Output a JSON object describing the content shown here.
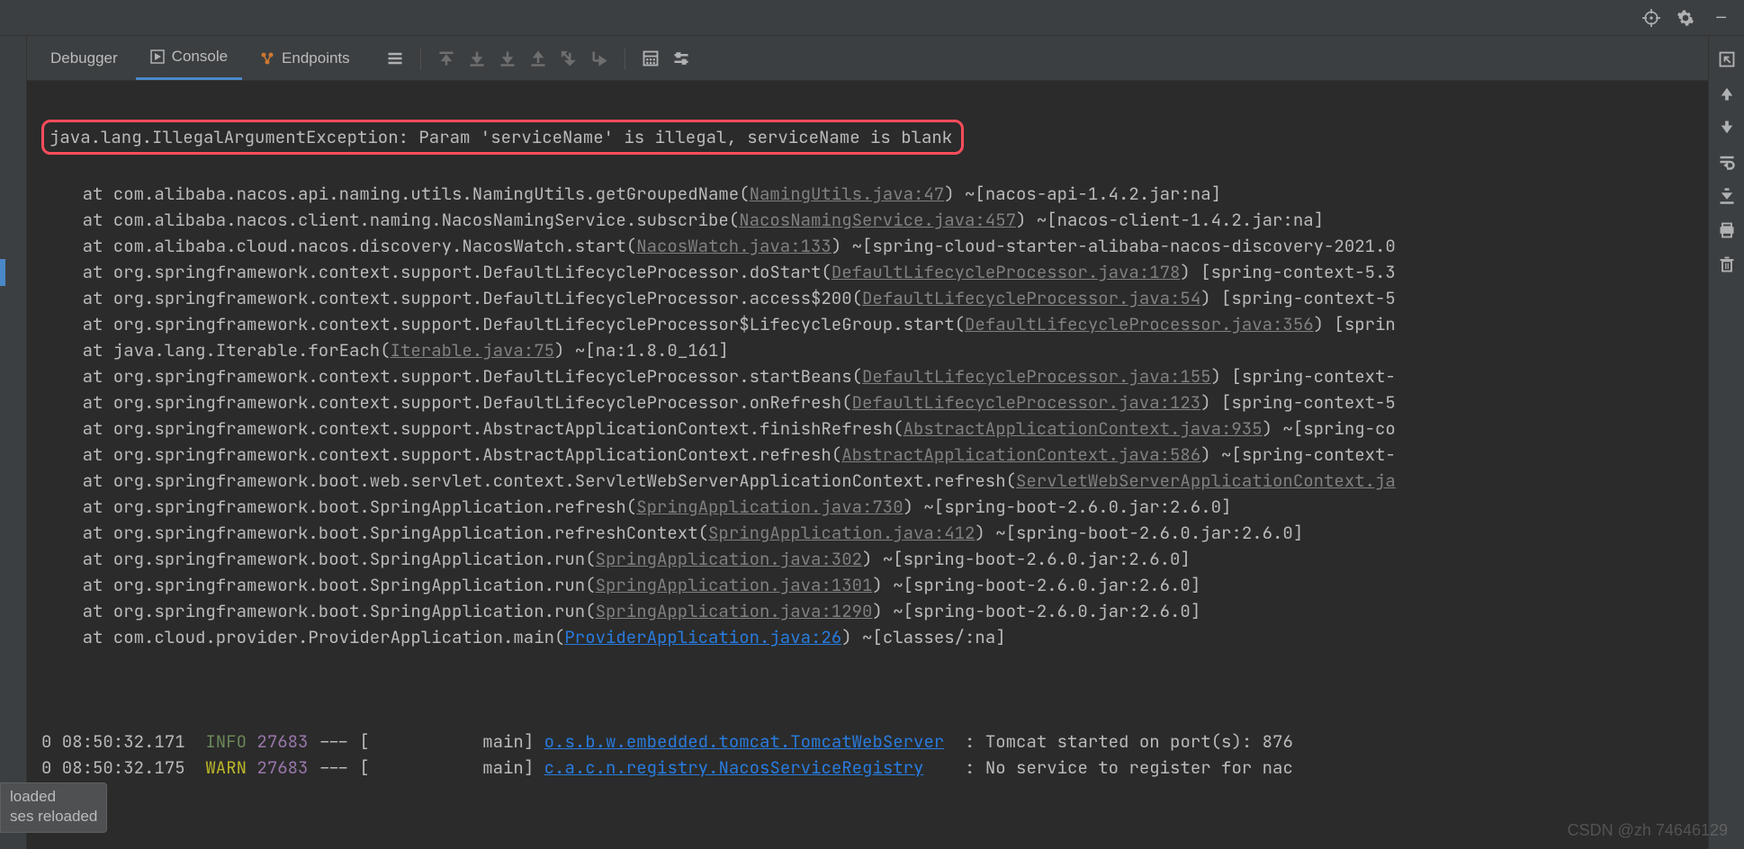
{
  "topbar": {},
  "tabs": {
    "debugger": "Debugger",
    "console": "Console",
    "endpoints": "Endpoints"
  },
  "exception": {
    "message": "java.lang.IllegalArgumentException: Param 'serviceName' is illegal, serviceName is blank"
  },
  "stack": [
    {
      "prefix": "    at com.alibaba.nacos.api.naming.utils.NamingUtils.getGroupedName(",
      "link": "NamingUtils.java:47",
      "linkClass": "grey",
      "suffix": ") ~[nacos-api-1.4.2.jar:na]"
    },
    {
      "prefix": "    at com.alibaba.nacos.client.naming.NacosNamingService.subscribe(",
      "link": "NacosNamingService.java:457",
      "linkClass": "grey",
      "suffix": ") ~[nacos-client-1.4.2.jar:na]"
    },
    {
      "prefix": "    at com.alibaba.cloud.nacos.discovery.NacosWatch.start(",
      "link": "NacosWatch.java:133",
      "linkClass": "grey",
      "suffix": ") ~[spring-cloud-starter-alibaba-nacos-discovery-2021.0"
    },
    {
      "prefix": "    at org.springframework.context.support.DefaultLifecycleProcessor.doStart(",
      "link": "DefaultLifecycleProcessor.java:178",
      "linkClass": "grey",
      "suffix": ") [spring-context-5.3"
    },
    {
      "prefix": "    at org.springframework.context.support.DefaultLifecycleProcessor.access$200(",
      "link": "DefaultLifecycleProcessor.java:54",
      "linkClass": "grey",
      "suffix": ") [spring-context-5"
    },
    {
      "prefix": "    at org.springframework.context.support.DefaultLifecycleProcessor$LifecycleGroup.start(",
      "link": "DefaultLifecycleProcessor.java:356",
      "linkClass": "grey",
      "suffix": ") [sprin"
    },
    {
      "prefix": "    at java.lang.Iterable.forEach(",
      "link": "Iterable.java:75",
      "linkClass": "grey",
      "suffix": ") ~[na:1.8.0_161]"
    },
    {
      "prefix": "    at org.springframework.context.support.DefaultLifecycleProcessor.startBeans(",
      "link": "DefaultLifecycleProcessor.java:155",
      "linkClass": "grey",
      "suffix": ") [spring-context-"
    },
    {
      "prefix": "    at org.springframework.context.support.DefaultLifecycleProcessor.onRefresh(",
      "link": "DefaultLifecycleProcessor.java:123",
      "linkClass": "grey",
      "suffix": ") [spring-context-5"
    },
    {
      "prefix": "    at org.springframework.context.support.AbstractApplicationContext.finishRefresh(",
      "link": "AbstractApplicationContext.java:935",
      "linkClass": "grey",
      "suffix": ") ~[spring-co"
    },
    {
      "prefix": "    at org.springframework.context.support.AbstractApplicationContext.refresh(",
      "link": "AbstractApplicationContext.java:586",
      "linkClass": "grey",
      "suffix": ") ~[spring-context-"
    },
    {
      "prefix": "    at org.springframework.boot.web.servlet.context.ServletWebServerApplicationContext.refresh(",
      "link": "ServletWebServerApplicationContext.ja",
      "linkClass": "grey",
      "suffix": ""
    },
    {
      "prefix": "    at org.springframework.boot.SpringApplication.refresh(",
      "link": "SpringApplication.java:730",
      "linkClass": "grey",
      "suffix": ") ~[spring-boot-2.6.0.jar:2.6.0]"
    },
    {
      "prefix": "    at org.springframework.boot.SpringApplication.refreshContext(",
      "link": "SpringApplication.java:412",
      "linkClass": "grey",
      "suffix": ") ~[spring-boot-2.6.0.jar:2.6.0]"
    },
    {
      "prefix": "    at org.springframework.boot.SpringApplication.run(",
      "link": "SpringApplication.java:302",
      "linkClass": "grey",
      "suffix": ") ~[spring-boot-2.6.0.jar:2.6.0]"
    },
    {
      "prefix": "    at org.springframework.boot.SpringApplication.run(",
      "link": "SpringApplication.java:1301",
      "linkClass": "grey",
      "suffix": ") ~[spring-boot-2.6.0.jar:2.6.0]"
    },
    {
      "prefix": "    at org.springframework.boot.SpringApplication.run(",
      "link": "SpringApplication.java:1290",
      "linkClass": "grey",
      "suffix": ") ~[spring-boot-2.6.0.jar:2.6.0]"
    },
    {
      "prefix": "    at com.cloud.provider.ProviderApplication.main(",
      "link": "ProviderApplication.java:26",
      "linkClass": "",
      "suffix": ") ~[classes/:na]"
    }
  ],
  "logs": [
    {
      "time": "0 08:50:32.171  ",
      "level": "INFO",
      "levelClass": "info",
      "pid": " 27683",
      "dashes": " --- [",
      "thread": "           main] ",
      "logger": "o.s.b.w.embedded.tomcat.TomcatWebServer",
      "msg": "  : Tomcat started on port(s): 876"
    },
    {
      "time": "0 08:50:32.175  ",
      "level": "WARN",
      "levelClass": "warn",
      "pid": " 27683",
      "dashes": " --- [",
      "thread": "           main] ",
      "logger": "c.a.c.n.registry.NacosServiceRegistry",
      "msg": "    : No service to register for nac"
    }
  ],
  "notify": {
    "line1": "loaded",
    "line2": "ses reloaded"
  },
  "watermark": "CSDN @zh 74646129"
}
